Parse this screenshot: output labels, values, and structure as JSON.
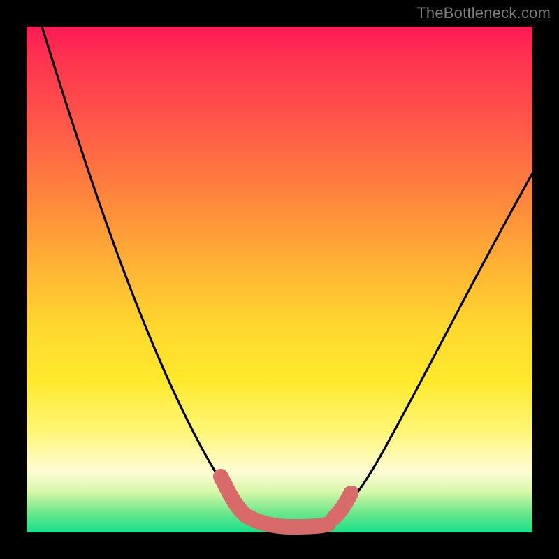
{
  "watermark": "TheBottleneck.com",
  "chart_data": {
    "type": "line",
    "title": "",
    "xlabel": "",
    "ylabel": "",
    "xlim": [
      0,
      100
    ],
    "ylim": [
      0,
      100
    ],
    "series": [
      {
        "name": "bottleneck-curve",
        "x": [
          0,
          5,
          10,
          15,
          20,
          25,
          30,
          35,
          40,
          42,
          45,
          48,
          50,
          52,
          55,
          58,
          60,
          65,
          70,
          75,
          80,
          85,
          90,
          95,
          100
        ],
        "values": [
          100,
          88,
          76,
          64,
          52,
          41,
          31,
          22,
          14,
          10,
          6,
          3,
          2,
          2,
          3,
          6,
          10,
          18,
          27,
          35,
          43,
          51,
          58,
          65,
          72
        ]
      }
    ],
    "markers": {
      "name": "highlighted-segment",
      "color": "#d96a6a",
      "x": [
        40,
        42,
        45,
        48,
        50,
        52,
        55,
        58,
        60
      ],
      "values": [
        14,
        10,
        6,
        3,
        2,
        2,
        3,
        6,
        10
      ]
    },
    "background_gradient": {
      "top": "#ff1a55",
      "mid1": "#ff8a3c",
      "mid2": "#ffe92c",
      "mid3": "#fefcd5",
      "bottom": "#17e08a"
    }
  }
}
